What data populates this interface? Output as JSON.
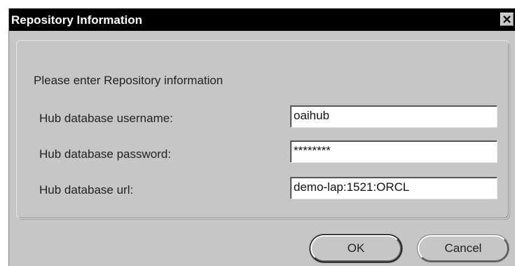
{
  "window": {
    "title": "Repository Information",
    "close_glyph": "✕"
  },
  "form": {
    "prompt": "Please enter Repository information",
    "fields": [
      {
        "label": "Hub database username:",
        "value": "oaihub"
      },
      {
        "label": "Hub database password:",
        "value": "********"
      },
      {
        "label": "Hub database url:",
        "value": "demo-lap:1521:ORCL"
      }
    ]
  },
  "buttons": {
    "ok_label": "OK",
    "cancel_label": "Cancel"
  },
  "colors": {
    "titlebar": "#000000",
    "dialog_background": "#c6c6c6",
    "input_background": "#ffffff"
  }
}
